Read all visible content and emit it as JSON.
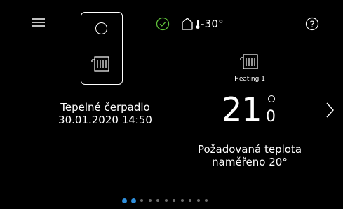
{
  "colors": {
    "background": "#000000",
    "foreground": "#ffffff",
    "ok_green": "#5fbf3a",
    "accent_blue": "#2f8fdc",
    "inactive_dot": "#6e6e6e",
    "divider": "#3a3a3a"
  },
  "header": {
    "menu_icon": "hamburger-menu-icon",
    "status_icon": "check-circle-icon",
    "outdoor_icon": "house-thermometer-icon",
    "outdoor_temperature": "-30°",
    "help_icon": "question-circle-icon"
  },
  "heat_pump": {
    "icon": "heat-pump-unit-icon",
    "name": "Tepelné čerpadlo",
    "datetime": "30.01.2020 14:50"
  },
  "heating_circuit": {
    "icon": "radiator-icon",
    "name": "Heating 1",
    "setpoint_integer": "21",
    "setpoint_decimal": "0",
    "label": "Požadovaná teplota",
    "measured": "naměřeno 20°"
  },
  "navigation": {
    "next_icon": "chevron-right-icon",
    "page_count": 11,
    "active_pages": [
      0,
      1
    ]
  }
}
